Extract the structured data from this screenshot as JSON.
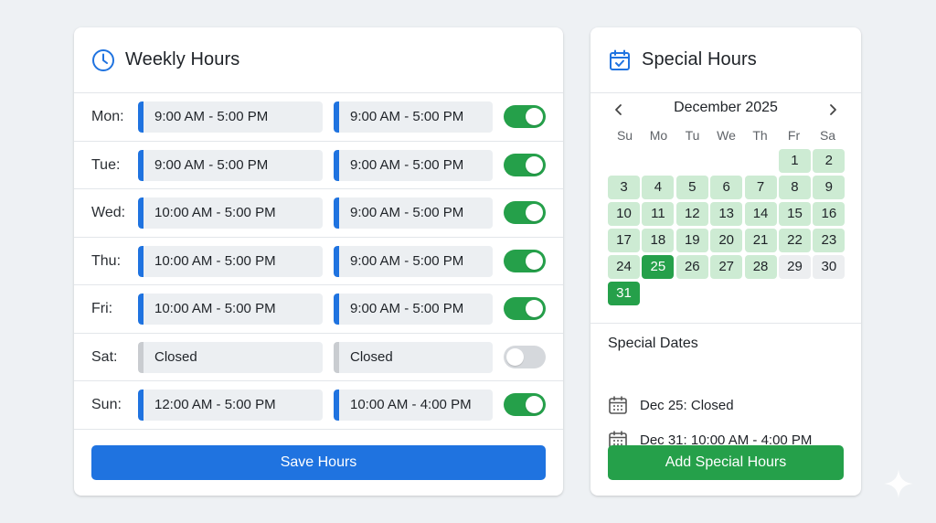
{
  "weekly": {
    "title": "Weekly Hours",
    "days": [
      {
        "day": "Mon:",
        "slot1": "9:00 AM - 5:00 PM",
        "slot2": "9:00 AM - 5:00 PM",
        "enabled": true
      },
      {
        "day": "Tue:",
        "slot1": "9:00 AM - 5:00 PM",
        "slot2": "9:00 AM - 5:00 PM",
        "enabled": true
      },
      {
        "day": "Wed:",
        "slot1": "10:00 AM - 5:00 PM",
        "slot2": "9:00 AM - 5:00 PM",
        "enabled": true
      },
      {
        "day": "Thu:",
        "slot1": "10:00 AM - 5:00 PM",
        "slot2": "9:00 AM - 5:00 PM",
        "enabled": true
      },
      {
        "day": "Fri:",
        "slot1": "10:00 AM - 5:00 PM",
        "slot2": "9:00 AM - 5:00 PM",
        "enabled": true
      },
      {
        "day": "Sat:",
        "slot1": "Closed",
        "slot2": "Closed",
        "enabled": false
      },
      {
        "day": "Sun:",
        "slot1": "12:00 AM - 5:00 PM",
        "slot2": "10:00 AM - 4:00 PM",
        "enabled": true
      }
    ],
    "save_label": "Save Hours"
  },
  "special": {
    "title": "Special Hours",
    "calendar": {
      "month_label": "December 2025",
      "weekdays": [
        "Su",
        "Mo",
        "Tu",
        "We",
        "Th",
        "Fr",
        "Sa"
      ],
      "leading_blanks": 5,
      "days": [
        "1",
        "2",
        "3",
        "4",
        "5",
        "6",
        "7",
        "8",
        "9",
        "10",
        "11",
        "12",
        "13",
        "14",
        "15",
        "16",
        "17",
        "18",
        "19",
        "20",
        "21",
        "22",
        "23",
        "24",
        "25",
        "26",
        "27",
        "28",
        "29",
        "30",
        "31"
      ],
      "selected_days": [
        "25",
        "31"
      ],
      "unavailable_days": [
        "29",
        "30"
      ]
    },
    "dates_title": "Special Dates",
    "dates": [
      "Dec 25: Closed",
      "Dec 31: 10:00 AM - 4:00 PM"
    ],
    "add_label": "Add Special Hours"
  },
  "colors": {
    "primary_blue": "#1f73e0",
    "primary_green": "#25a04a",
    "available_green": "#cdebd3",
    "toggle_off": "#d5d8dc"
  },
  "icons": {
    "weekly": "clock-icon",
    "special": "calendar-check-icon",
    "date_item": "calendar-grid-icon",
    "prev": "chevron-left-icon",
    "next": "chevron-right-icon"
  }
}
